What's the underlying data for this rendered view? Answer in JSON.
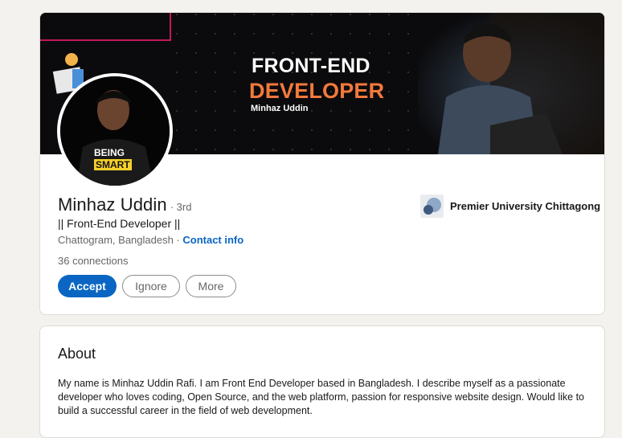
{
  "profile": {
    "banner": {
      "headline_line1": "FRONT-END",
      "headline_line2": "DEVELOPER",
      "byline": "Minhaz Uddin",
      "shirt_text_1": "BEING",
      "shirt_text_2": "SMART"
    },
    "name": "Minhaz Uddin",
    "degree": "· 3rd",
    "headline": "|| Front-End Developer ||",
    "location": "Chattogram, Bangladesh",
    "location_separator": " · ",
    "contact_info_label": "Contact info",
    "connections": "36 connections",
    "actions": {
      "accept_label": "Accept",
      "ignore_label": "Ignore",
      "more_label": "More"
    },
    "education": {
      "name": "Premier University Chittagong"
    },
    "colors": {
      "accent": "#0a66c2",
      "banner_orange": "#f4793b",
      "banner_bg": "#0b0b0d"
    }
  },
  "about": {
    "title": "About",
    "text": "My name is Minhaz Uddin Rafi. I am Front End Developer based in Bangladesh. I describe myself as a passionate developer who loves coding, Open Source, and the web platform, passion for responsive website design. Would like to build a successful career in the field of web development."
  }
}
